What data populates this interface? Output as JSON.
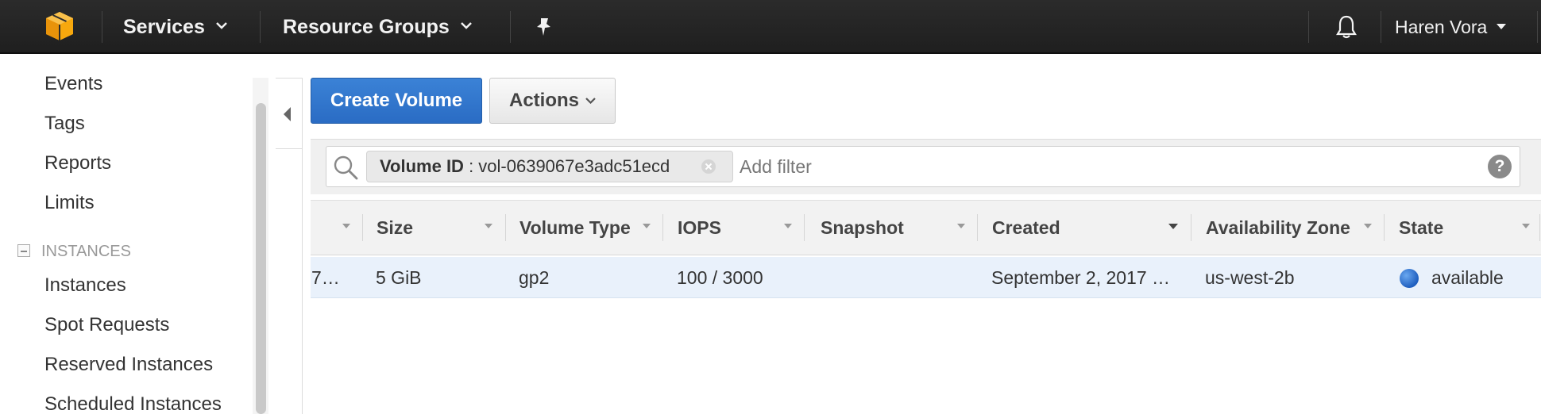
{
  "nav": {
    "services_label": "Services",
    "resource_groups_label": "Resource Groups",
    "user_name": "Haren Vora"
  },
  "sidebar": {
    "items_top": [
      "Events",
      "Tags",
      "Reports",
      "Limits"
    ],
    "section_label": "INSTANCES",
    "items_instances": [
      "Instances",
      "Spot Requests",
      "Reserved Instances",
      "Scheduled Instances"
    ]
  },
  "toolbar": {
    "create_label": "Create Volume",
    "actions_label": "Actions"
  },
  "filter": {
    "chip_key": "Volume ID",
    "chip_value": " : vol-0639067e3adc51ecd",
    "placeholder": "Add filter",
    "help_label": "?"
  },
  "table": {
    "columns": [
      "Size",
      "Volume Type",
      "IOPS",
      "Snapshot",
      "Created",
      "Availability Zone",
      "State"
    ],
    "rows": [
      {
        "truncated_first": "7…",
        "size": "5 GiB",
        "volume_type": "gp2",
        "iops": "100 / 3000",
        "snapshot": "",
        "created": "September 2, 2017 …",
        "availability_zone": "us-west-2b",
        "state": "available"
      }
    ]
  },
  "colors": {
    "nav_bg": "#232323",
    "primary_button": "#2f74cc",
    "row_selected": "#e9f1fb",
    "state_available": "#2f74d6"
  }
}
